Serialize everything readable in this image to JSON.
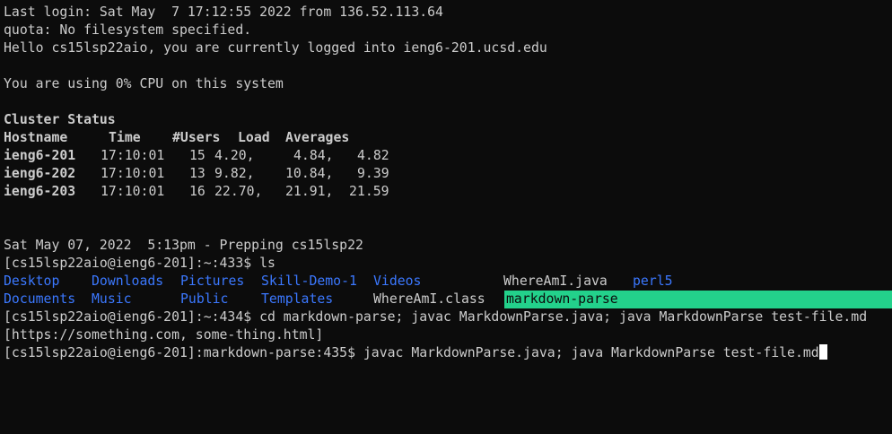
{
  "terminal": {
    "colors": {
      "background": "#0c0c0c",
      "foreground": "#cccccc",
      "directory": "#3b78ff",
      "highlight": "#23d18b"
    },
    "motd": {
      "last_login": "Last login: Sat May  7 17:12:55 2022 from 136.52.113.64",
      "quota": "quota: No filesystem specified.",
      "hello": "Hello cs15lsp22aio, you are currently logged into ieng6-201.ucsd.edu",
      "cpu": "You are using 0% CPU on this system"
    },
    "cluster": {
      "title": "Cluster Status",
      "header": {
        "hostname": "Hostname",
        "time": "Time",
        "users": "#Users",
        "load": "Load",
        "averages": "Averages"
      },
      "rows": [
        {
          "host": "ieng6-201",
          "time": "17:10:01",
          "users": "15",
          "l1": "4.20,",
          "l2": "4.84,",
          "l3": "4.82"
        },
        {
          "host": "ieng6-202",
          "time": "17:10:01",
          "users": "13",
          "l1": "9.82,",
          "l2": "10.84,",
          "l3": "9.39"
        },
        {
          "host": "ieng6-203",
          "time": "17:10:01",
          "users": "16",
          "l1": "22.70,",
          "l2": "21.91,",
          "l3": "21.59"
        }
      ]
    },
    "prepping": "Sat May 07, 2022  5:13pm - Prepping cs15lsp22",
    "commands": [
      {
        "prompt": "[cs15lsp22aio@ieng6-201]:~:433$ ",
        "cmd": "ls"
      },
      {
        "prompt": "[cs15lsp22aio@ieng6-201]:~:434$ ",
        "cmd": "cd markdown-parse; javac MarkdownParse.java; java MarkdownParse test-file.md"
      },
      {
        "prompt": "[cs15lsp22aio@ieng6-201]:markdown-parse:435$ ",
        "cmd": "javac MarkdownParse.java; java MarkdownParse test-file.md"
      }
    ],
    "ls": {
      "row1": [
        "Desktop",
        "Downloads",
        "Pictures",
        "Skill-Demo-1",
        "Videos",
        "WhereAmI.java",
        "perl5"
      ],
      "row2": [
        "Documents",
        "Music",
        "Public",
        "Templates",
        "WhereAmI.class",
        "markdown-parse"
      ]
    },
    "program_output": "[https://something.com, some-thing.html]"
  }
}
